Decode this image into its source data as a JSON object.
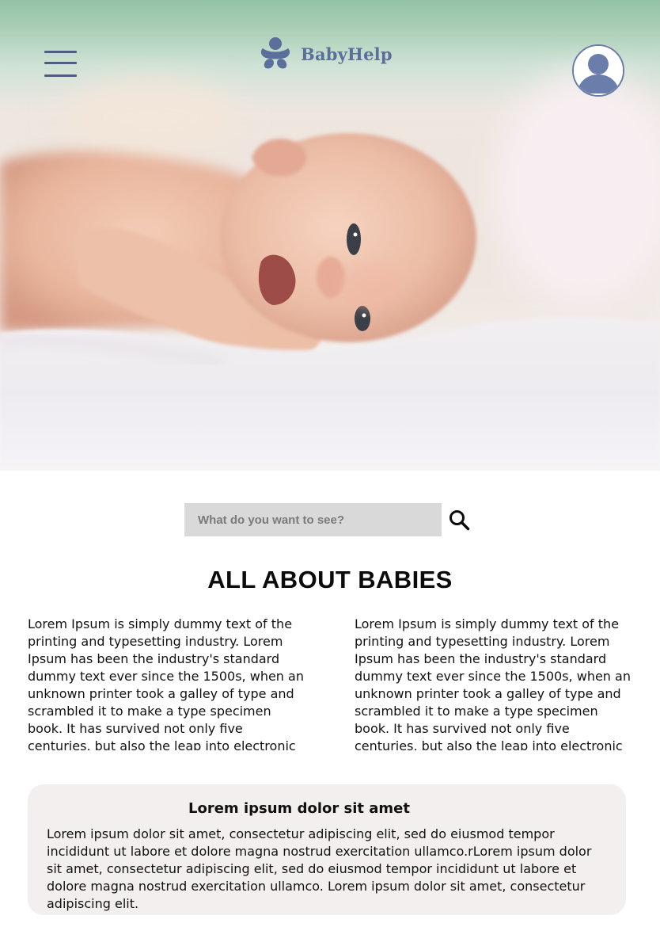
{
  "header": {
    "brand": "BabyHelp"
  },
  "hero": {
    "image_icon": "baby-photo"
  },
  "search": {
    "placeholder": "What do you want to see?",
    "icon": "search-icon"
  },
  "main": {
    "title": "ALL ABOUT BABIES",
    "column_left": "Lorem Ipsum is simply dummy text of the printing and typesetting industry. Lorem Ipsum has been the industry's standard dummy text ever since the 1500s, when an unknown printer took a galley of type and scrambled it to make a type specimen book. It has survived not only five centuries, but also the leap into electronic typesetting,",
    "column_right": "Lorem Ipsum is simply dummy text of the printing and typesetting industry. Lorem Ipsum has been the industry's standard dummy text ever since the 1500s, when an unknown printer took a galley of type and scrambled it to make a type specimen book. It has survived not only five centuries, but also the leap into electronic typesetting,"
  },
  "card": {
    "title": "Lorem ipsum dolor sit amet",
    "body": "Lorem ipsum dolor sit amet, consectetur adipiscing elit, sed do eiusmod tempor incididunt ut labore et dolore magna  nostrud exercitation ullamco.rLorem ipsum dolor sit amet, consectetur adipiscing elit, sed do eiusmod tempor incididunt ut labore et dolore magna nostrud exercitation ullamco. Lorem ipsum dolor sit amet, consectetur adipiscing elit."
  },
  "colors": {
    "accent": "#5a6f99",
    "header_green": "#93c2a8",
    "card_bg": "#f3efee",
    "search_bg": "#d9d9d9"
  }
}
